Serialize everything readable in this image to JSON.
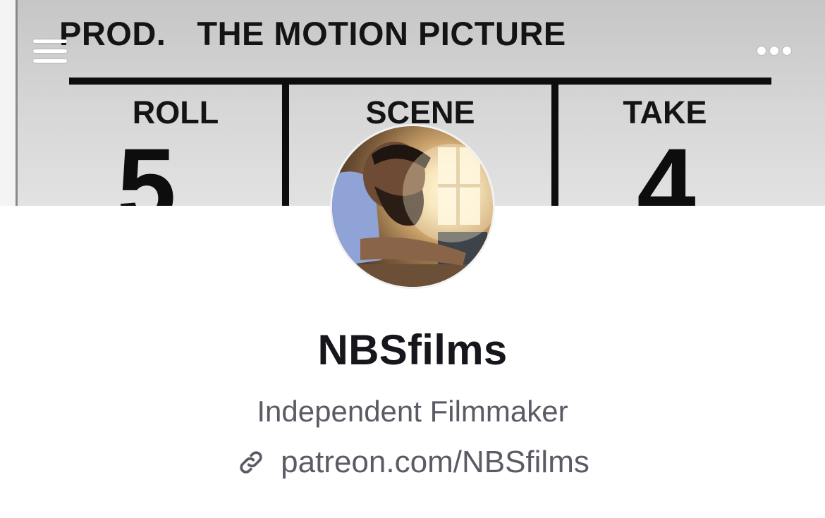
{
  "banner": {
    "slate": {
      "prod_label": "PROD.",
      "title": "THE MOTION PICTURE",
      "columns": [
        {
          "label": "ROLL",
          "value": "5"
        },
        {
          "label": "SCENE",
          "value": ""
        },
        {
          "label": "TAKE",
          "value": "4"
        }
      ]
    }
  },
  "toolbar": {
    "menu_icon": "hamburger-menu-icon",
    "more_icon": "more-horizontal-icon",
    "icon_color": "#ffffff"
  },
  "profile": {
    "name": "NBSfilms",
    "bio": "Independent Filmmaker",
    "link": {
      "icon": "link-icon",
      "text": "patreon.com/NBSfilms"
    }
  },
  "colors": {
    "name_text": "#16161c",
    "secondary_text": "#5b5b66",
    "background": "#ffffff"
  }
}
